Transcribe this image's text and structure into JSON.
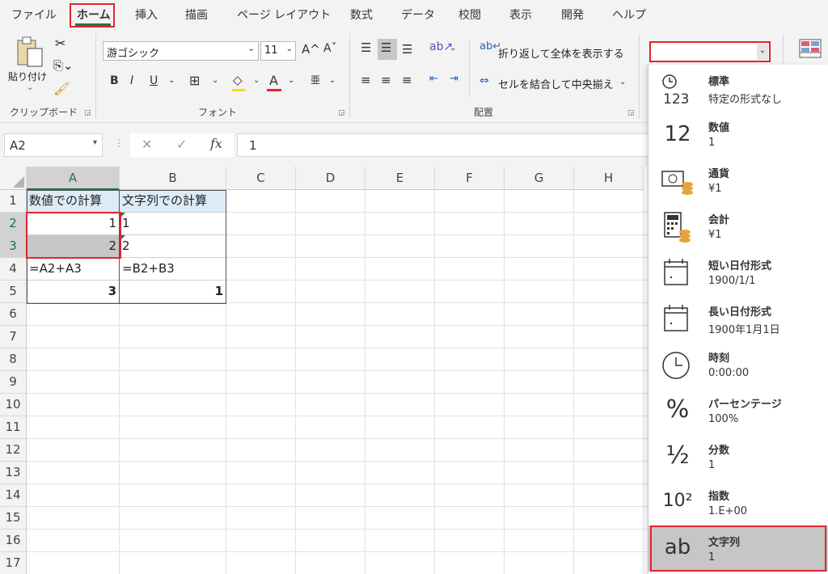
{
  "tabs": [
    "ファイル",
    "ホーム",
    "挿入",
    "描画",
    "ページ レイアウト",
    "数式",
    "データ",
    "校閲",
    "表示",
    "開発",
    "ヘルプ"
  ],
  "active_tab": "ホーム",
  "ribbon": {
    "clipboard": {
      "paste_label": "貼り付け",
      "group_label": "クリップボード"
    },
    "font": {
      "name": "游ゴシック",
      "size": "11",
      "bold": "B",
      "italic": "I",
      "underline": "U",
      "grow": "A^",
      "shrink": "Aˇ",
      "font_color": "A",
      "phonetic": "亜",
      "group_label": "フォント"
    },
    "align": {
      "wrap_label": "折り返して全体を表示する",
      "merge_label": "セルを結合して中央揃え",
      "group_label": "配置"
    },
    "number_format_value": ""
  },
  "formula_bar": {
    "name_box": "A2",
    "cancel": "✕",
    "enter": "✓",
    "fx": "fx",
    "value": "1"
  },
  "columns": [
    "A",
    "B",
    "C",
    "D",
    "E",
    "F",
    "G",
    "H"
  ],
  "rows": [
    "1",
    "2",
    "3",
    "4",
    "5",
    "6",
    "7",
    "8",
    "9",
    "10",
    "11",
    "12",
    "13",
    "14",
    "15",
    "16",
    "17"
  ],
  "cells": {
    "A1": "数値での計算",
    "B1": "文字列での計算",
    "A2": "1",
    "B2": "1",
    "A3": "2",
    "B3": "2",
    "A4": "=A2+A3",
    "B4": "=B2+B3",
    "A5": "3",
    "B5": "1"
  },
  "format_menu": [
    {
      "icon": "clock-123-icon",
      "glyph": "123",
      "title": "標準",
      "sample": "特定の形式なし"
    },
    {
      "icon": "number-12-icon",
      "glyph": "12",
      "title": "数値",
      "sample": "1"
    },
    {
      "icon": "currency-icon",
      "glyph": "",
      "title": "通貨",
      "sample": "¥1"
    },
    {
      "icon": "accounting-icon",
      "glyph": "",
      "title": "会計",
      "sample": " ¥1"
    },
    {
      "icon": "short-date-icon",
      "glyph": "",
      "title": "短い日付形式",
      "sample": "1900/1/1"
    },
    {
      "icon": "long-date-icon",
      "glyph": "",
      "title": "長い日付形式",
      "sample": "1900年1月1日"
    },
    {
      "icon": "time-icon",
      "glyph": "",
      "title": "時刻",
      "sample": "0:00:00"
    },
    {
      "icon": "percent-icon",
      "glyph": "%",
      "title": "パーセンテージ",
      "sample": "100%"
    },
    {
      "icon": "fraction-icon",
      "glyph": "½",
      "title": "分数",
      "sample": "1"
    },
    {
      "icon": "scientific-icon",
      "glyph": "10²",
      "title": "指数",
      "sample": "1.E+00"
    },
    {
      "icon": "text-ab-icon",
      "glyph": "ab",
      "title": "文字列",
      "sample": "1"
    }
  ],
  "colors": {
    "accent_red": "#e0242e",
    "excel_green": "#217346",
    "selection_gray": "#c6c6c6"
  }
}
